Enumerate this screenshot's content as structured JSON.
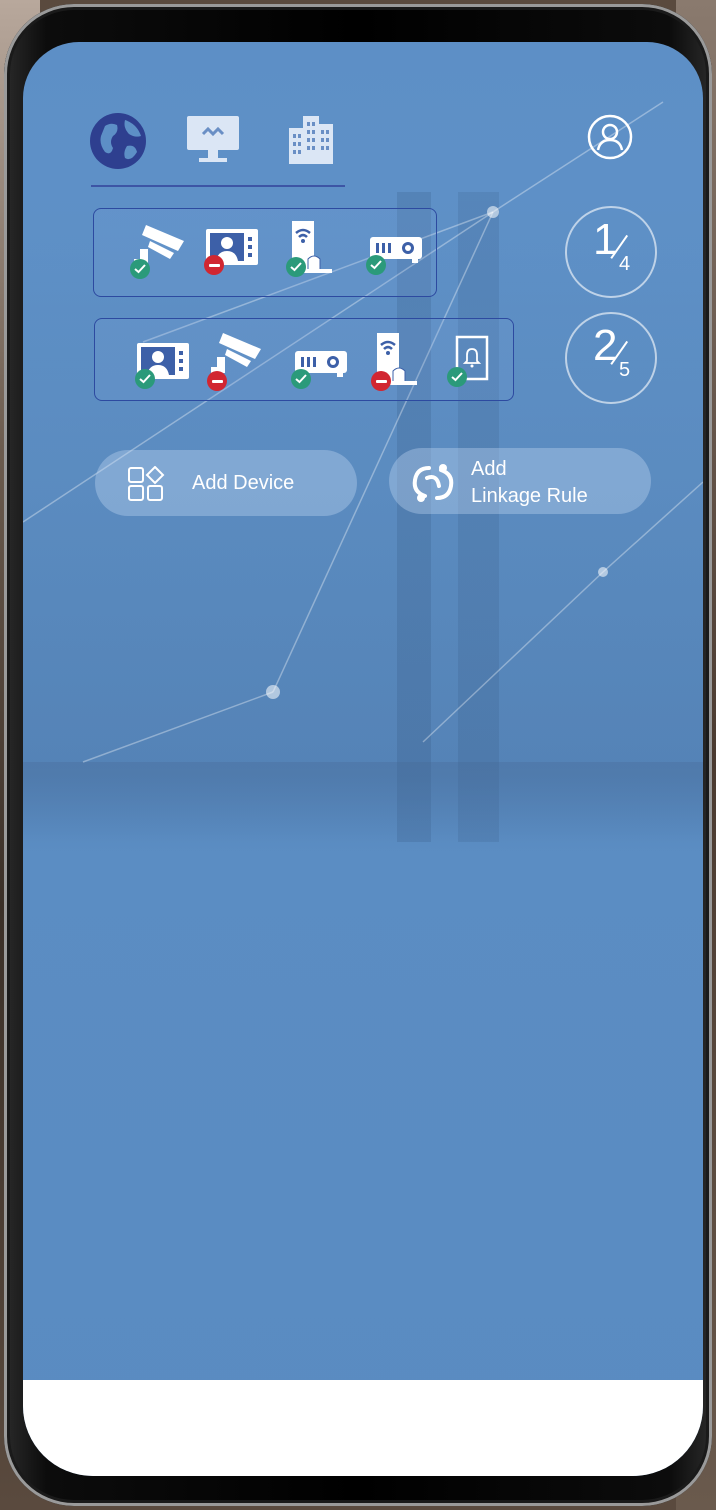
{
  "nav": {
    "tabs": [
      {
        "name": "globe-icon",
        "active": true
      },
      {
        "name": "monitor-icon",
        "active": false
      },
      {
        "name": "building-icon",
        "active": false
      }
    ],
    "accent": "#3d55a5"
  },
  "groups": [
    {
      "counter": {
        "current": "1",
        "total": "4"
      },
      "devices": [
        {
          "icon": "camera-icon",
          "status": "online"
        },
        {
          "icon": "video-intercom-icon",
          "status": "offline"
        },
        {
          "icon": "wifi-door-station-icon",
          "status": "online"
        },
        {
          "icon": "projector-icon",
          "status": "online"
        }
      ]
    },
    {
      "counter": {
        "current": "2",
        "total": "5"
      },
      "devices": [
        {
          "icon": "video-intercom-icon",
          "status": "online"
        },
        {
          "icon": "camera-icon",
          "status": "offline"
        },
        {
          "icon": "projector-icon",
          "status": "online"
        },
        {
          "icon": "wifi-door-station-icon",
          "status": "offline"
        },
        {
          "icon": "doorbell-panel-icon",
          "status": "online"
        }
      ]
    }
  ],
  "actions": {
    "add_device": "Add Device",
    "add_linkage_line1": "Add",
    "add_linkage_line2": "Linkage Rule"
  },
  "colors": {
    "online": "#2b9a7a",
    "offline": "#d12631",
    "screen_bg": "#5d8fc6"
  }
}
